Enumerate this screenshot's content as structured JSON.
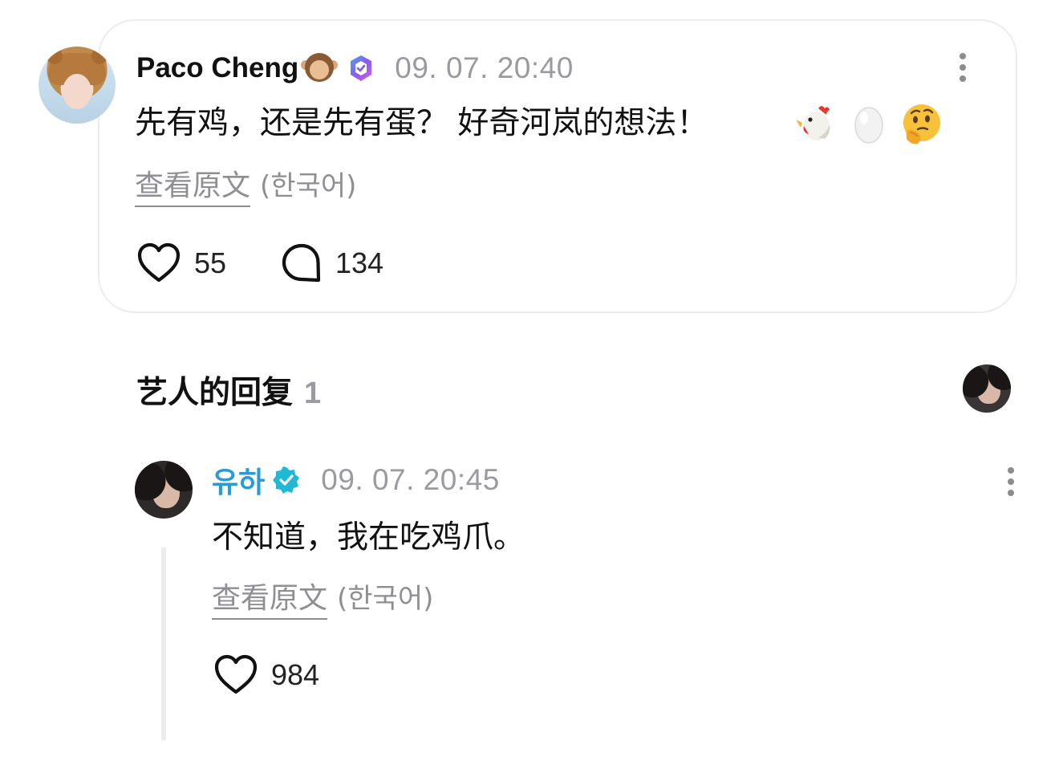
{
  "post": {
    "author": "Paco Cheng",
    "author_emoji": "monkey-face-emoji",
    "badge": "purple-check-badge",
    "timestamp": "09. 07. 20:40",
    "text": "先有鸡，还是先有蛋？ 好奇河岚的想法！",
    "emojis": [
      "chicken-emoji",
      "egg-emoji",
      "thinking-face-emoji"
    ],
    "translate_label": "查看原文",
    "translate_lang": "(한국어)",
    "likes": "55",
    "comments": "134"
  },
  "replies_section": {
    "title": "艺人的回复",
    "count": "1"
  },
  "reply": {
    "author": "유하",
    "badge": "teal-verified-badge",
    "timestamp": "09. 07. 20:45",
    "text": "不知道，我在吃鸡爪。",
    "translate_label": "查看原文",
    "translate_lang": "(한국어)",
    "likes": "984"
  },
  "colors": {
    "reply_author": "#2a9bd6",
    "muted_text": "#9a9aa0",
    "card_border": "#ececef",
    "post_badge": "#7b5cf0",
    "reply_badge": "#21b8d6"
  }
}
